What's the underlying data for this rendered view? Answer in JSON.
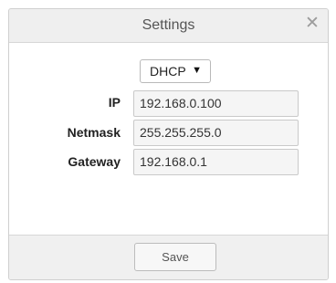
{
  "dialog": {
    "title": "Settings",
    "close_glyph": "✕",
    "close_icon": "close-icon"
  },
  "mode_select": {
    "value": "DHCP",
    "arrow_glyph": "▼",
    "arrow_icon": "caret-down-icon"
  },
  "fields": {
    "ip": {
      "label": "IP",
      "value": "192.168.0.100"
    },
    "netmask": {
      "label": "Netmask",
      "value": "255.255.255.0"
    },
    "gateway": {
      "label": "Gateway",
      "value": "192.168.0.1"
    }
  },
  "footer": {
    "save_label": "Save"
  }
}
